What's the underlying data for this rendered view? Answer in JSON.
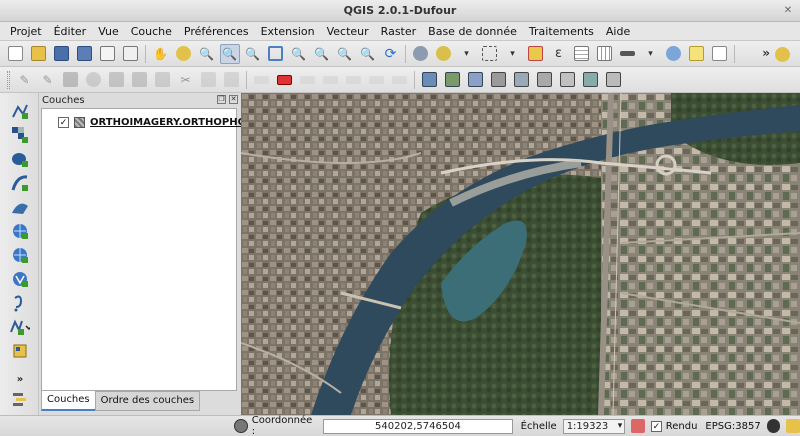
{
  "window": {
    "title": "QGIS 2.0.1-Dufour"
  },
  "menu": [
    "Projet",
    "Éditer",
    "Vue",
    "Couche",
    "Préférences",
    "Extension",
    "Vecteur",
    "Raster",
    "Base de donnée",
    "Traitements",
    "Aide"
  ],
  "toolbar": {
    "overflow_label": "»"
  },
  "layers_panel": {
    "title": "Couches",
    "layers": [
      {
        "name": "ORTHOIMAGERY.ORTHOPHO...",
        "checked": "✓"
      }
    ],
    "tabs": [
      "Couches",
      "Ordre des couches"
    ],
    "more_label": "»"
  },
  "statusbar": {
    "coord_label": "Coordonnée :",
    "coord_value": "540202,5746504",
    "scale_label": "Échelle",
    "scale_value": "1:19323",
    "render_label": "Rendu",
    "render_checked": "✓",
    "crs_label": "EPSG:3857"
  },
  "colors": {
    "accent": "#4a7fc1",
    "river": "#2e4a5c",
    "lake": "#3c6e78"
  }
}
